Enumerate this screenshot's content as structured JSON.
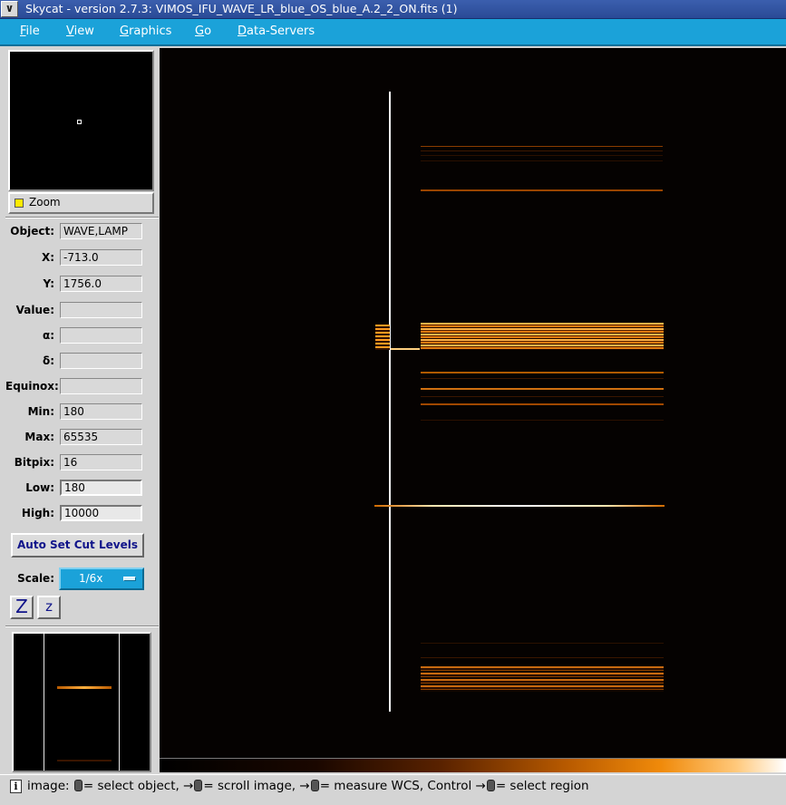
{
  "window": {
    "title": "Skycat - version 2.7.3: VIMOS_IFU_WAVE_LR_blue_OS_blue_A.2_2_ON.fits (1)",
    "menu_glyph": "∨"
  },
  "menubar": {
    "items": [
      {
        "mnemonic": "F",
        "rest": "ile"
      },
      {
        "mnemonic": "V",
        "rest": "iew"
      },
      {
        "mnemonic": "G",
        "rest": "raphics"
      },
      {
        "mnemonic": "G",
        "rest": "o"
      },
      {
        "mnemonic": "D",
        "rest": "ata-Servers"
      }
    ]
  },
  "zoom": {
    "label": "Zoom",
    "checked": true
  },
  "info_fields": [
    {
      "label": "Object:",
      "value": "WAVE,LAMP"
    },
    {
      "label": "X:",
      "value": "-713.0"
    },
    {
      "label": "Y:",
      "value": "1756.0"
    },
    {
      "label": "Value:",
      "value": ""
    },
    {
      "label": "α:",
      "value": ""
    },
    {
      "label": "δ:",
      "value": ""
    },
    {
      "label": "Equinox:",
      "value": ""
    },
    {
      "label": "Min:",
      "value": "180"
    },
    {
      "label": "Max:",
      "value": "65535"
    },
    {
      "label": "Bitpix:",
      "value": "16"
    },
    {
      "label": "Low:",
      "value": "180"
    },
    {
      "label": "High:",
      "value": "10000"
    }
  ],
  "cut_levels": {
    "button_label": "Auto Set Cut Levels"
  },
  "scale": {
    "label": "Scale:",
    "value": "1/6x"
  },
  "zoom_buttons": {
    "zoom_in_label": "Z",
    "zoom_out_label": "z"
  },
  "colors": {
    "accent": "#1ba2d9",
    "title_bar": "#3b5fae",
    "spectrum": "#f08a0a",
    "image_bg": "#050201"
  },
  "statusbar": {
    "info_glyph": "i",
    "segments": [
      "image: ",
      "= select object, →",
      "= scroll image, →",
      "= measure WCS, Control →",
      "= select region"
    ]
  }
}
